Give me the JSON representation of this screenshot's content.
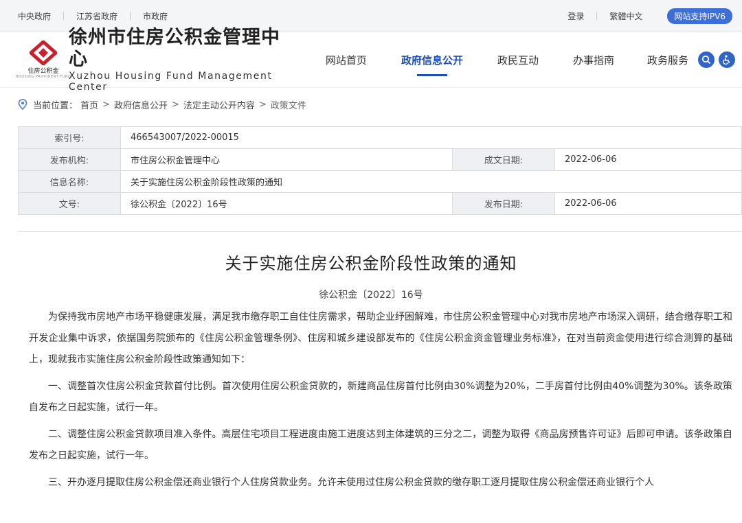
{
  "topbar": {
    "links": [
      "中央政府",
      "江苏省政府",
      "市政府"
    ],
    "login": "登录",
    "lang": "繁體中文",
    "ipv6": "网站支持IPV6"
  },
  "header": {
    "logo_cn": "徐州市住房公积金管理中心",
    "logo_en": "Xuzhou Housing Fund Management Center",
    "logo_sub": "住房公积金",
    "logo_tiny": "HOUSING PROVIDENT FUND",
    "nav": [
      "网站首页",
      "政府信息公开",
      "政民互动",
      "办事指南",
      "政务服务"
    ],
    "active_nav": 1
  },
  "breadcrumb": {
    "label": "当前位置：",
    "items": [
      "首页",
      "政府信息公开",
      "法定主动公开内容"
    ],
    "current": "政策文件"
  },
  "info": {
    "index_label": "索引号:",
    "index_value": "466543007/2022-00015",
    "org_label": "发布机构:",
    "org_value": "市住房公积金管理中心",
    "created_label": "成文日期:",
    "created_value": "2022-06-06",
    "name_label": "信息名称:",
    "name_value": "关于实施住房公积金阶段性政策的通知",
    "docno_label": "文号:",
    "docno_value": "徐公积金〔2022〕16号",
    "published_label": "发布日期:",
    "published_value": "2022-06-06"
  },
  "article": {
    "title": "关于实施住房公积金阶段性政策的通知",
    "docno": "徐公积金〔2022〕16号",
    "paragraphs": [
      "为保持我市房地产市场平稳健康发展，满足我市缴存职工自住住房需求，帮助企业纾困解难，市住房公积金管理中心对我市房地产市场深入调研，结合缴存职工和开发企业集中诉求，依据国务院颁布的《住房公积金管理条例》、住房和城乡建设部发布的《住房公积金资金管理业务标准》，在对当前资金使用进行综合测算的基础上，现就我市实施住房公积金阶段性政策通知如下：",
      "一、调整首次住房公积金贷款首付比例。首次使用住房公积金贷款的，新建商品住房首付比例由30%调整为20%，二手房首付比例由40%调整为30%。该条政策自发布之日起实施，试行一年。",
      "二、调整住房公积金贷款项目准入条件。高层住宅项目工程进度由施工进度达到主体建筑的三分之二，调整为取得《商品房预售许可证》后即可申请。该条政策自发布之日起实施，试行一年。",
      "三、开办逐月提取住房公积金偿还商业银行个人住房贷款业务。允许未使用过住房公积金贷款的缴存职工逐月提取住房公积金偿还商业银行个人"
    ]
  }
}
